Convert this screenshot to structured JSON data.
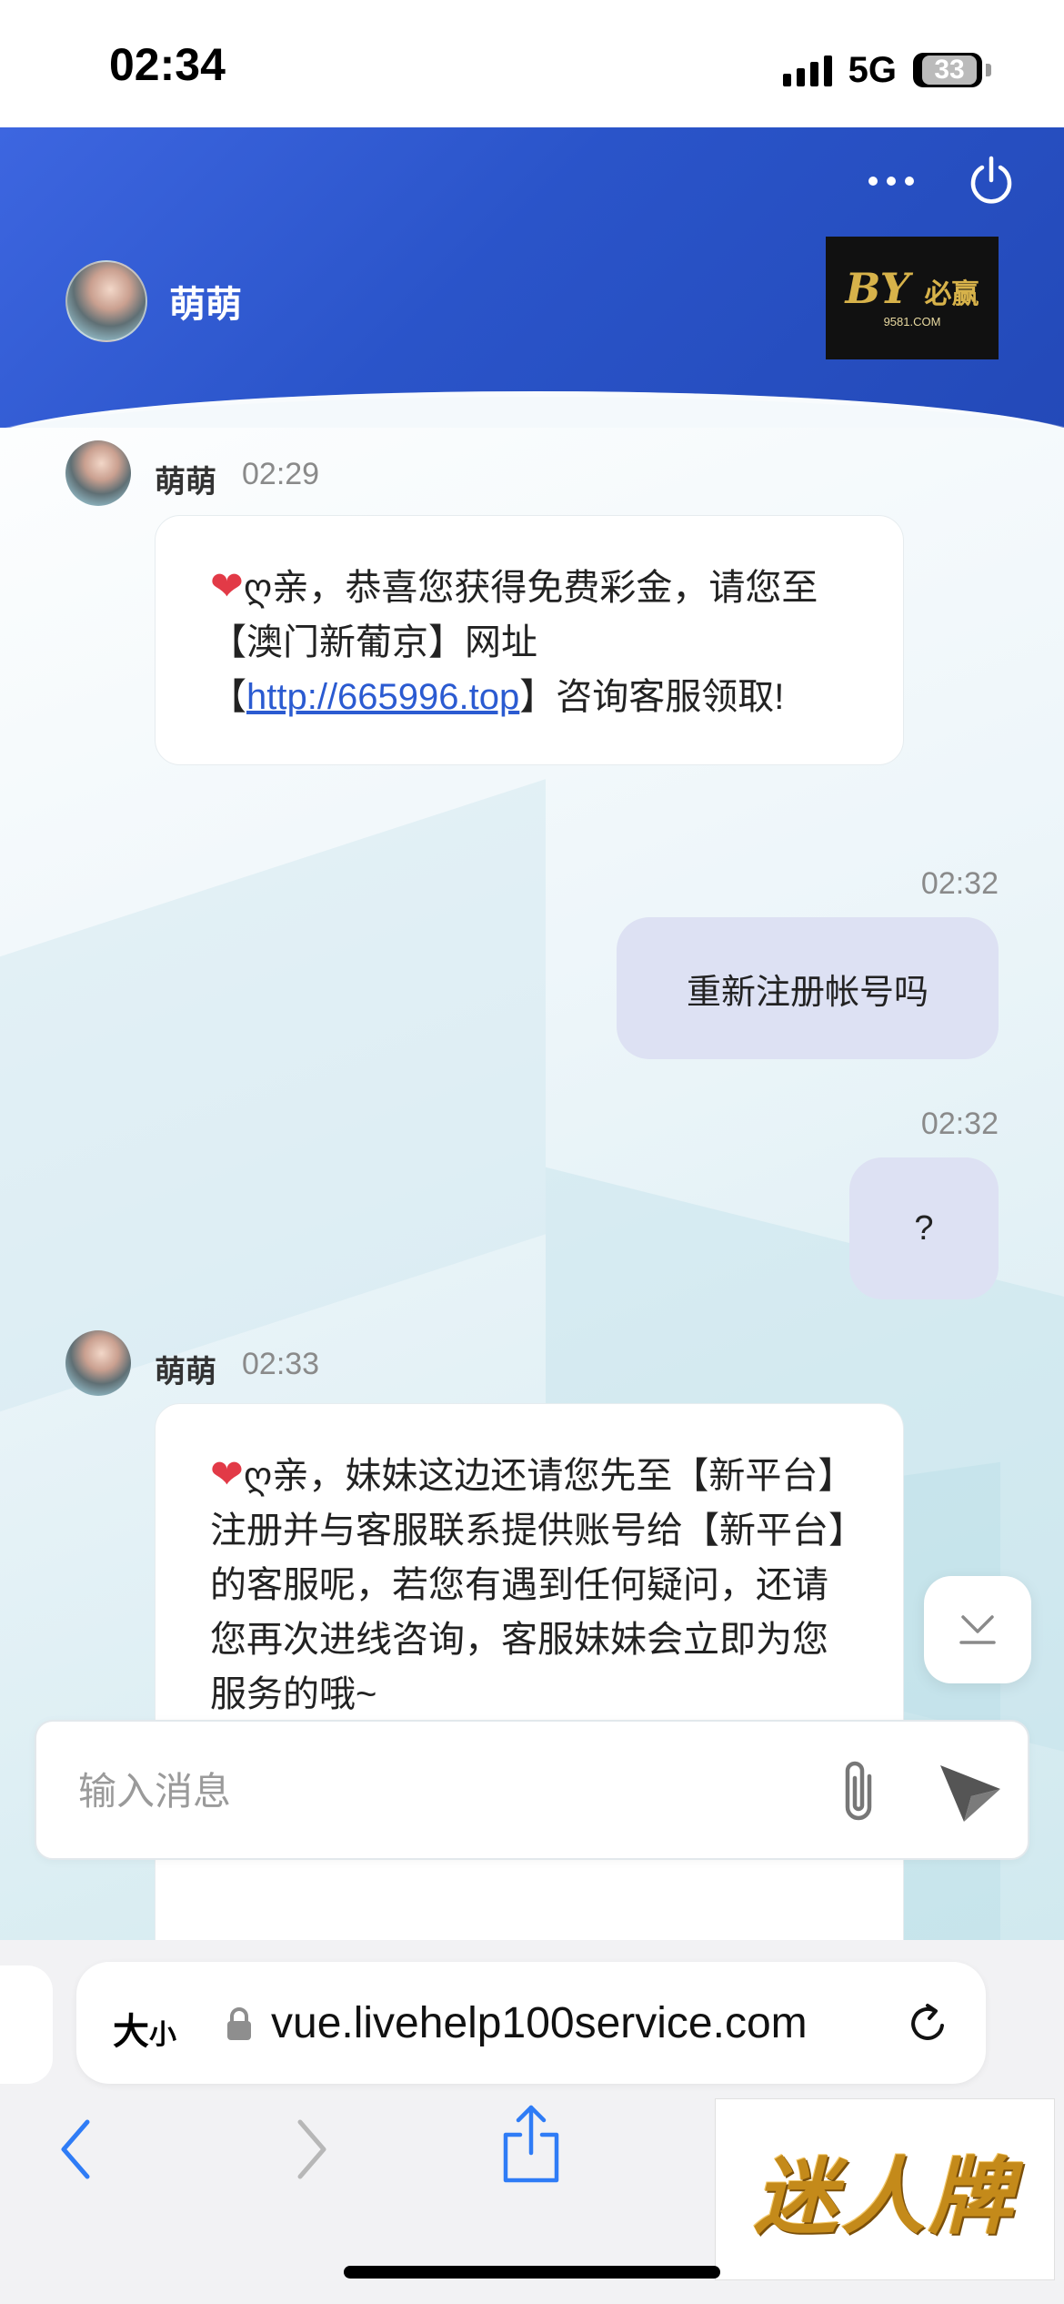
{
  "status_bar": {
    "time": "02:34",
    "network": "5G",
    "battery": "33"
  },
  "header": {
    "agent_name": "萌萌",
    "more_icon": "more-horizontal-icon",
    "power_icon": "power-icon",
    "brand_logo_text": "必赢",
    "brand_logo_sub": "9581.COM",
    "gradient_colors": [
      "#3d66e0",
      "#2349b8"
    ]
  },
  "messages": [
    {
      "direction": "in",
      "sender": "萌萌",
      "time": "02:29",
      "heart": "❤️",
      "text_before_link": "ღ亲，恭喜您获得免费彩金，请您至【澳门新葡京】网址【",
      "link": "http://665996.top",
      "text_after_link": "】咨询客服领取!"
    },
    {
      "direction": "out",
      "time": "02:32",
      "text": "重新注册帐号吗"
    },
    {
      "direction": "out",
      "time": "02:32",
      "text": "?"
    },
    {
      "direction": "in",
      "sender": "萌萌",
      "time": "02:33",
      "heart": "❤️",
      "text": "ღ亲，妹妹这边还请您先至【新平台】注册并与客服联系提供账号给【新平台】的客服呢，若您有遇到任何疑问，还请您再次进线咨询，客服妹妹会立即为您服务的哦~"
    }
  ],
  "composer": {
    "placeholder": "输入消息",
    "value": ""
  },
  "browser": {
    "text_size_label": "大",
    "text_size_small": "小",
    "url": "vue.livehelp100service.com"
  },
  "watermark": {
    "text": "迷人牌"
  },
  "colors": {
    "outgoing_bubble": "#dde1f3",
    "link": "#2b5bd1",
    "heart": "#e23a47"
  }
}
